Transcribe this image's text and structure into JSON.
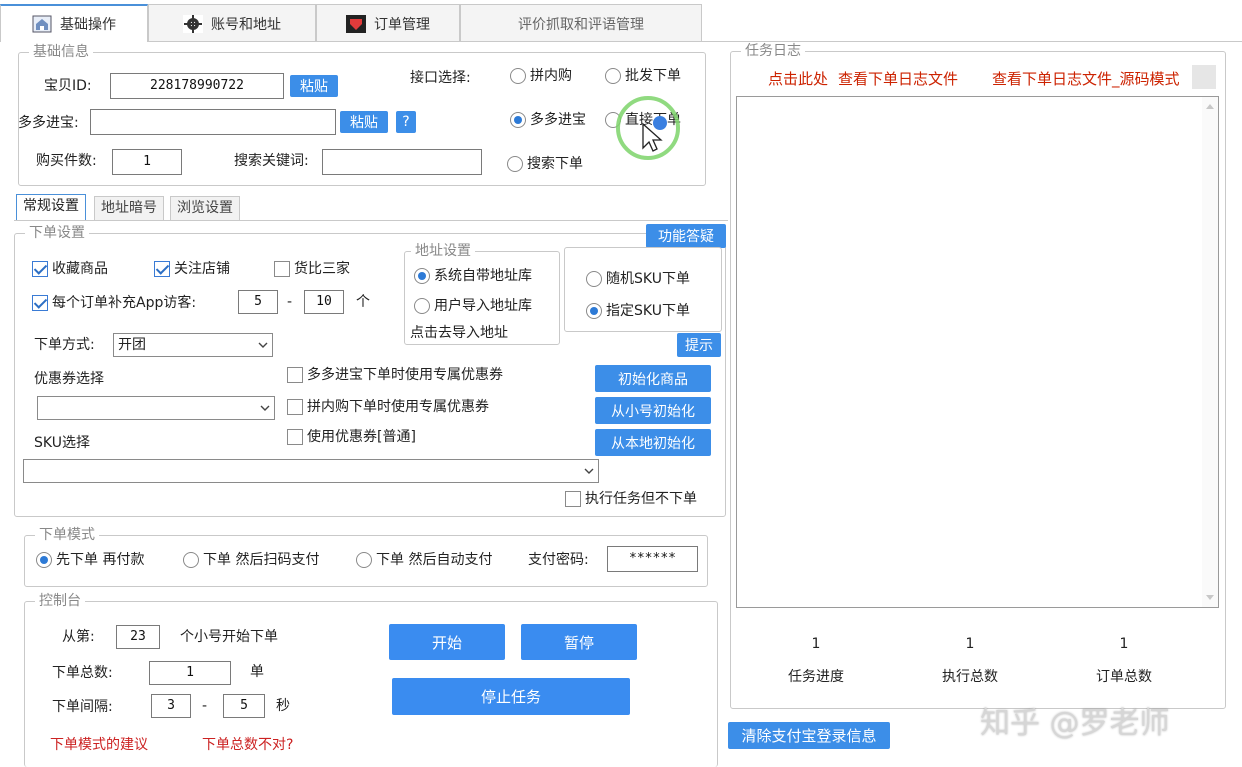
{
  "tabs": [
    {
      "label": "基础操作",
      "icon": "home-icon"
    },
    {
      "label": "账号和地址",
      "icon": "gear-icon"
    },
    {
      "label": "订单管理",
      "icon": "shield-icon"
    },
    {
      "label": "评价抓取和评语管理",
      "icon": ""
    }
  ],
  "basic": {
    "legend": "基础信息",
    "item_id_label": "宝贝ID:",
    "item_id_value": "228178990722",
    "paste_label": "粘贴",
    "duoduo_label": "多多进宝:",
    "duoduo_value": "",
    "help_label": "?",
    "qty_label": "购买件数:",
    "qty_value": "1",
    "keyword_label": "搜索关键词:",
    "keyword_value": "",
    "interface_label": "接口选择:",
    "interfaces": [
      "拼内购",
      "批发下单",
      "多多进宝",
      "直接下单",
      "搜索下单"
    ],
    "interface_selected": "多多进宝"
  },
  "subtabs": [
    "常规设置",
    "地址暗号",
    "浏览设置"
  ],
  "order": {
    "legend": "下单设置",
    "faq_label": "功能答疑",
    "fav_label": "收藏商品",
    "follow_label": "关注店铺",
    "compare_label": "货比三家",
    "visitors_label": "每个订单补充App访客:",
    "visitors_min": "5",
    "visitors_dash": "-",
    "visitors_max": "10",
    "visitors_unit": "个",
    "address_legend": "地址设置",
    "addr_system": "系统自带地址库",
    "addr_user": "用户导入地址库",
    "addr_import_link": "点击去导入地址",
    "sku_random": "随机SKU下单",
    "sku_specified": "指定SKU下单",
    "tip_label": "提示",
    "method_label": "下单方式:",
    "method_value": "开团",
    "coupon_label": "优惠券选择",
    "coupon_value": "",
    "coupon_opt1": "多多进宝下单时使用专属优惠券",
    "coupon_opt2": "拼内购下单时使用专属优惠券",
    "coupon_opt3": "使用优惠券[普通]",
    "init_goods": "初始化商品",
    "init_from_account": "从小号初始化",
    "init_from_local": "从本地初始化",
    "sku_label": "SKU选择",
    "sku_value": "",
    "exec_no_order": "执行任务但不下单"
  },
  "mode": {
    "legend": "下单模式",
    "opt1": "先下单 再付款",
    "opt2": "下单 然后扫码支付",
    "opt3": "下单 然后自动支付",
    "pay_pwd_label": "支付密码:",
    "pay_pwd_value": "******"
  },
  "console": {
    "legend": "控制台",
    "from_label": "从第:",
    "from_value": "23",
    "from_suffix": "个小号开始下单",
    "total_label": "下单总数:",
    "total_value": "1",
    "total_unit": "单",
    "interval_label": "下单间隔:",
    "interval_min": "3",
    "interval_dash": "-",
    "interval_max": "5",
    "interval_unit": "秒",
    "start": "开始",
    "pause": "暂停",
    "stop": "停止任务",
    "advice_link": "下单模式的建议",
    "wrong_total_link": "下单总数不对?"
  },
  "log": {
    "legend": "任务日志",
    "link_click_here": "点击此处",
    "link_view_log": "查看下单日志文件",
    "link_view_source": "查看下单日志文件_源码模式",
    "progress_value": "1",
    "progress_label": "任务进度",
    "exec_value": "1",
    "exec_label": "执行总数",
    "orders_value": "1",
    "orders_label": "订单总数",
    "clear_alipay": "清除支付宝登录信息"
  },
  "watermark": "知乎 @罗老师",
  "colors": {
    "accent": "#3c8ee8",
    "link_red": "#cc2200",
    "cursor_ring": "#7dd36a"
  }
}
